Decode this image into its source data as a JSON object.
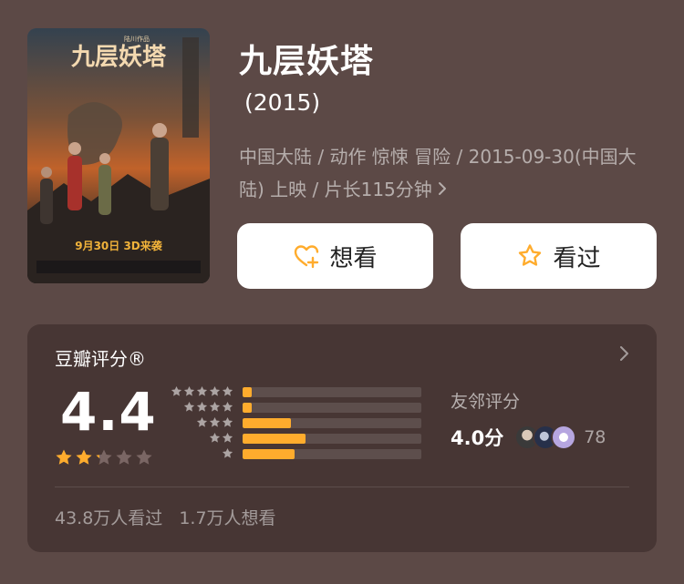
{
  "movie": {
    "title": "九层妖塔",
    "year": "(2015)",
    "meta": "中国大陆 / 动作 惊悚 冒险 / 2015-09-30(中国大陆) 上映 / 片长115分钟",
    "poster": {
      "title_text": "九层妖塔",
      "top_text": "陆川作品",
      "release_text": "9月30日 3D来袭"
    }
  },
  "actions": {
    "want_label": "想看",
    "seen_label": "看过"
  },
  "rating": {
    "section_title": "豆瓣评分®",
    "score": "4.4",
    "score_stars": 2.2,
    "distribution": [
      {
        "stars": 5,
        "percent": 4
      },
      {
        "stars": 4,
        "percent": 4
      },
      {
        "stars": 3,
        "percent": 27
      },
      {
        "stars": 2,
        "percent": 35
      },
      {
        "stars": 1,
        "percent": 29
      }
    ],
    "friends_label": "友邻评分",
    "friends_score": "4.0分",
    "friends_count": "78",
    "watched_text": "43.8万人看过",
    "wish_text": "1.7万人想看"
  },
  "colors": {
    "background": "#5c4946",
    "card": "#473634",
    "accent": "#ffac2d",
    "star_empty": "#7a6664"
  },
  "icons": {
    "want": "heart-plus-icon",
    "seen": "star-outline-icon",
    "meta_arrow": "chevron-right-icon",
    "card_arrow": "chevron-right-icon"
  }
}
